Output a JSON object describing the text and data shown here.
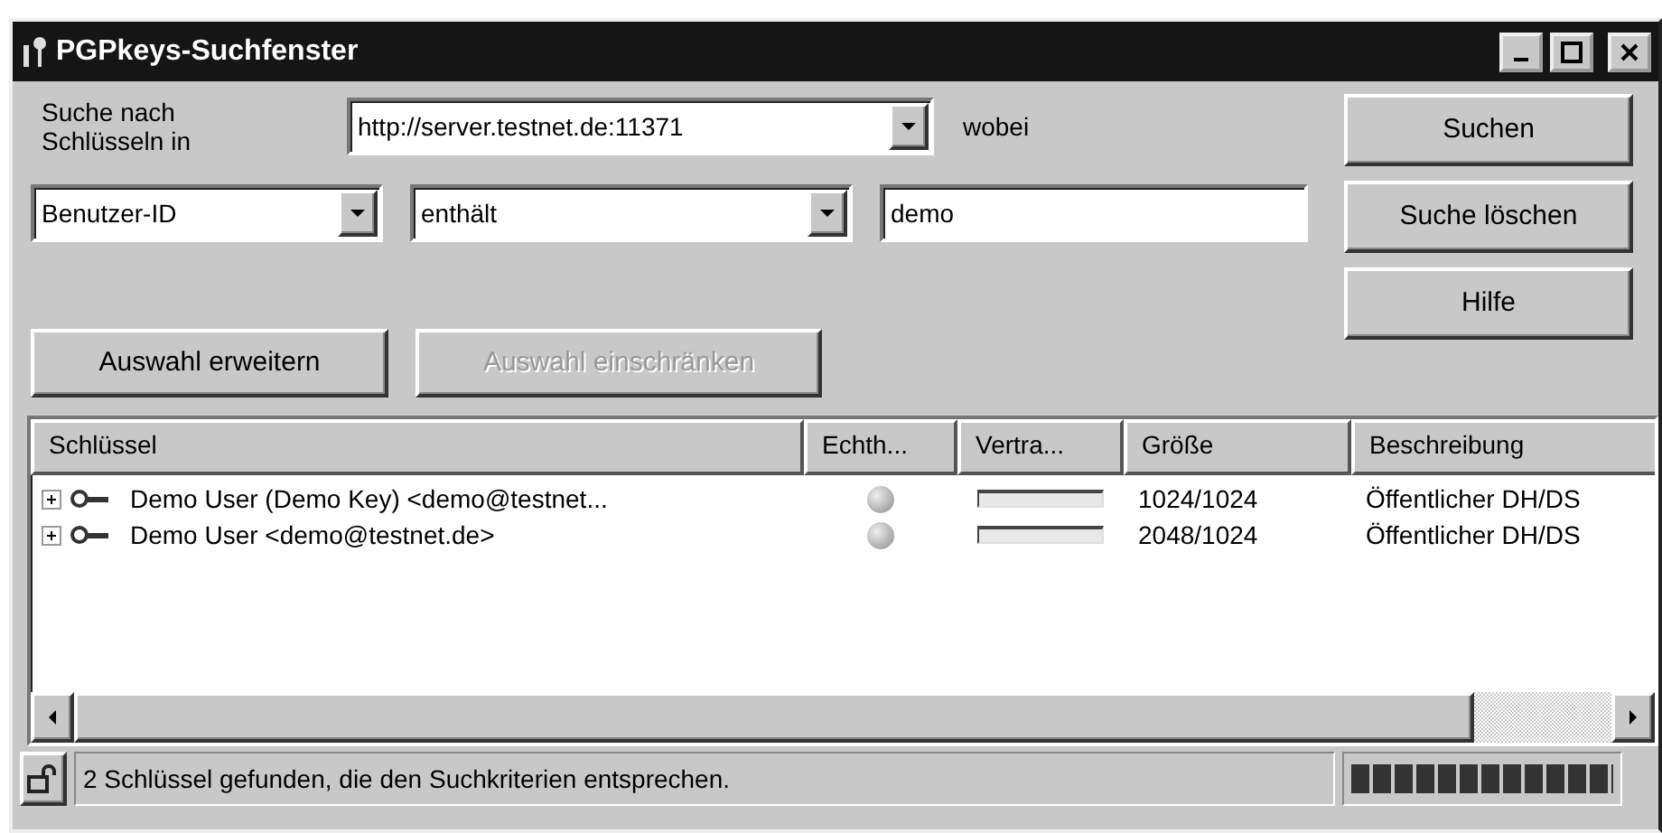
{
  "window": {
    "title": "PGPkeys-Suchfenster"
  },
  "search": {
    "label": "Suche nach Schlüsseln in",
    "server": "http://server.testnet.de:11371",
    "where_label": "wobei",
    "attribute": "Benutzer-ID",
    "operator": "enthält",
    "value": "demo"
  },
  "buttons": [
    {
      "label": "Suchen",
      "disabled": false
    },
    {
      "label": "Suche löschen",
      "disabled": false
    },
    {
      "label": "Hilfe",
      "disabled": false
    }
  ],
  "selection_buttons": [
    {
      "label": "Auswahl erweitern",
      "disabled": false
    },
    {
      "label": "Auswahl einschränken",
      "disabled": true
    }
  ],
  "table": {
    "columns": [
      "Schlüssel",
      "Echth...",
      "Vertra...",
      "Größe",
      "Beschreibung"
    ],
    "rows": [
      {
        "expanded": false,
        "key": "Demo User (Demo Key) <demo@testnet...",
        "trust": {
          "level": 0
        },
        "size": "1024/1024",
        "description": "Öffentlicher DH/DS"
      },
      {
        "expanded": false,
        "key": "Demo User <demo@testnet.de>",
        "trust": {
          "level": 0
        },
        "size": "2048/1024",
        "description": "Öffentlicher DH/DS"
      }
    ]
  },
  "status_bar": {
    "text": "2 Schlüssel gefunden, die den Suchkriterien entsprechen.",
    "progress": {
      "level": 1
    }
  }
}
